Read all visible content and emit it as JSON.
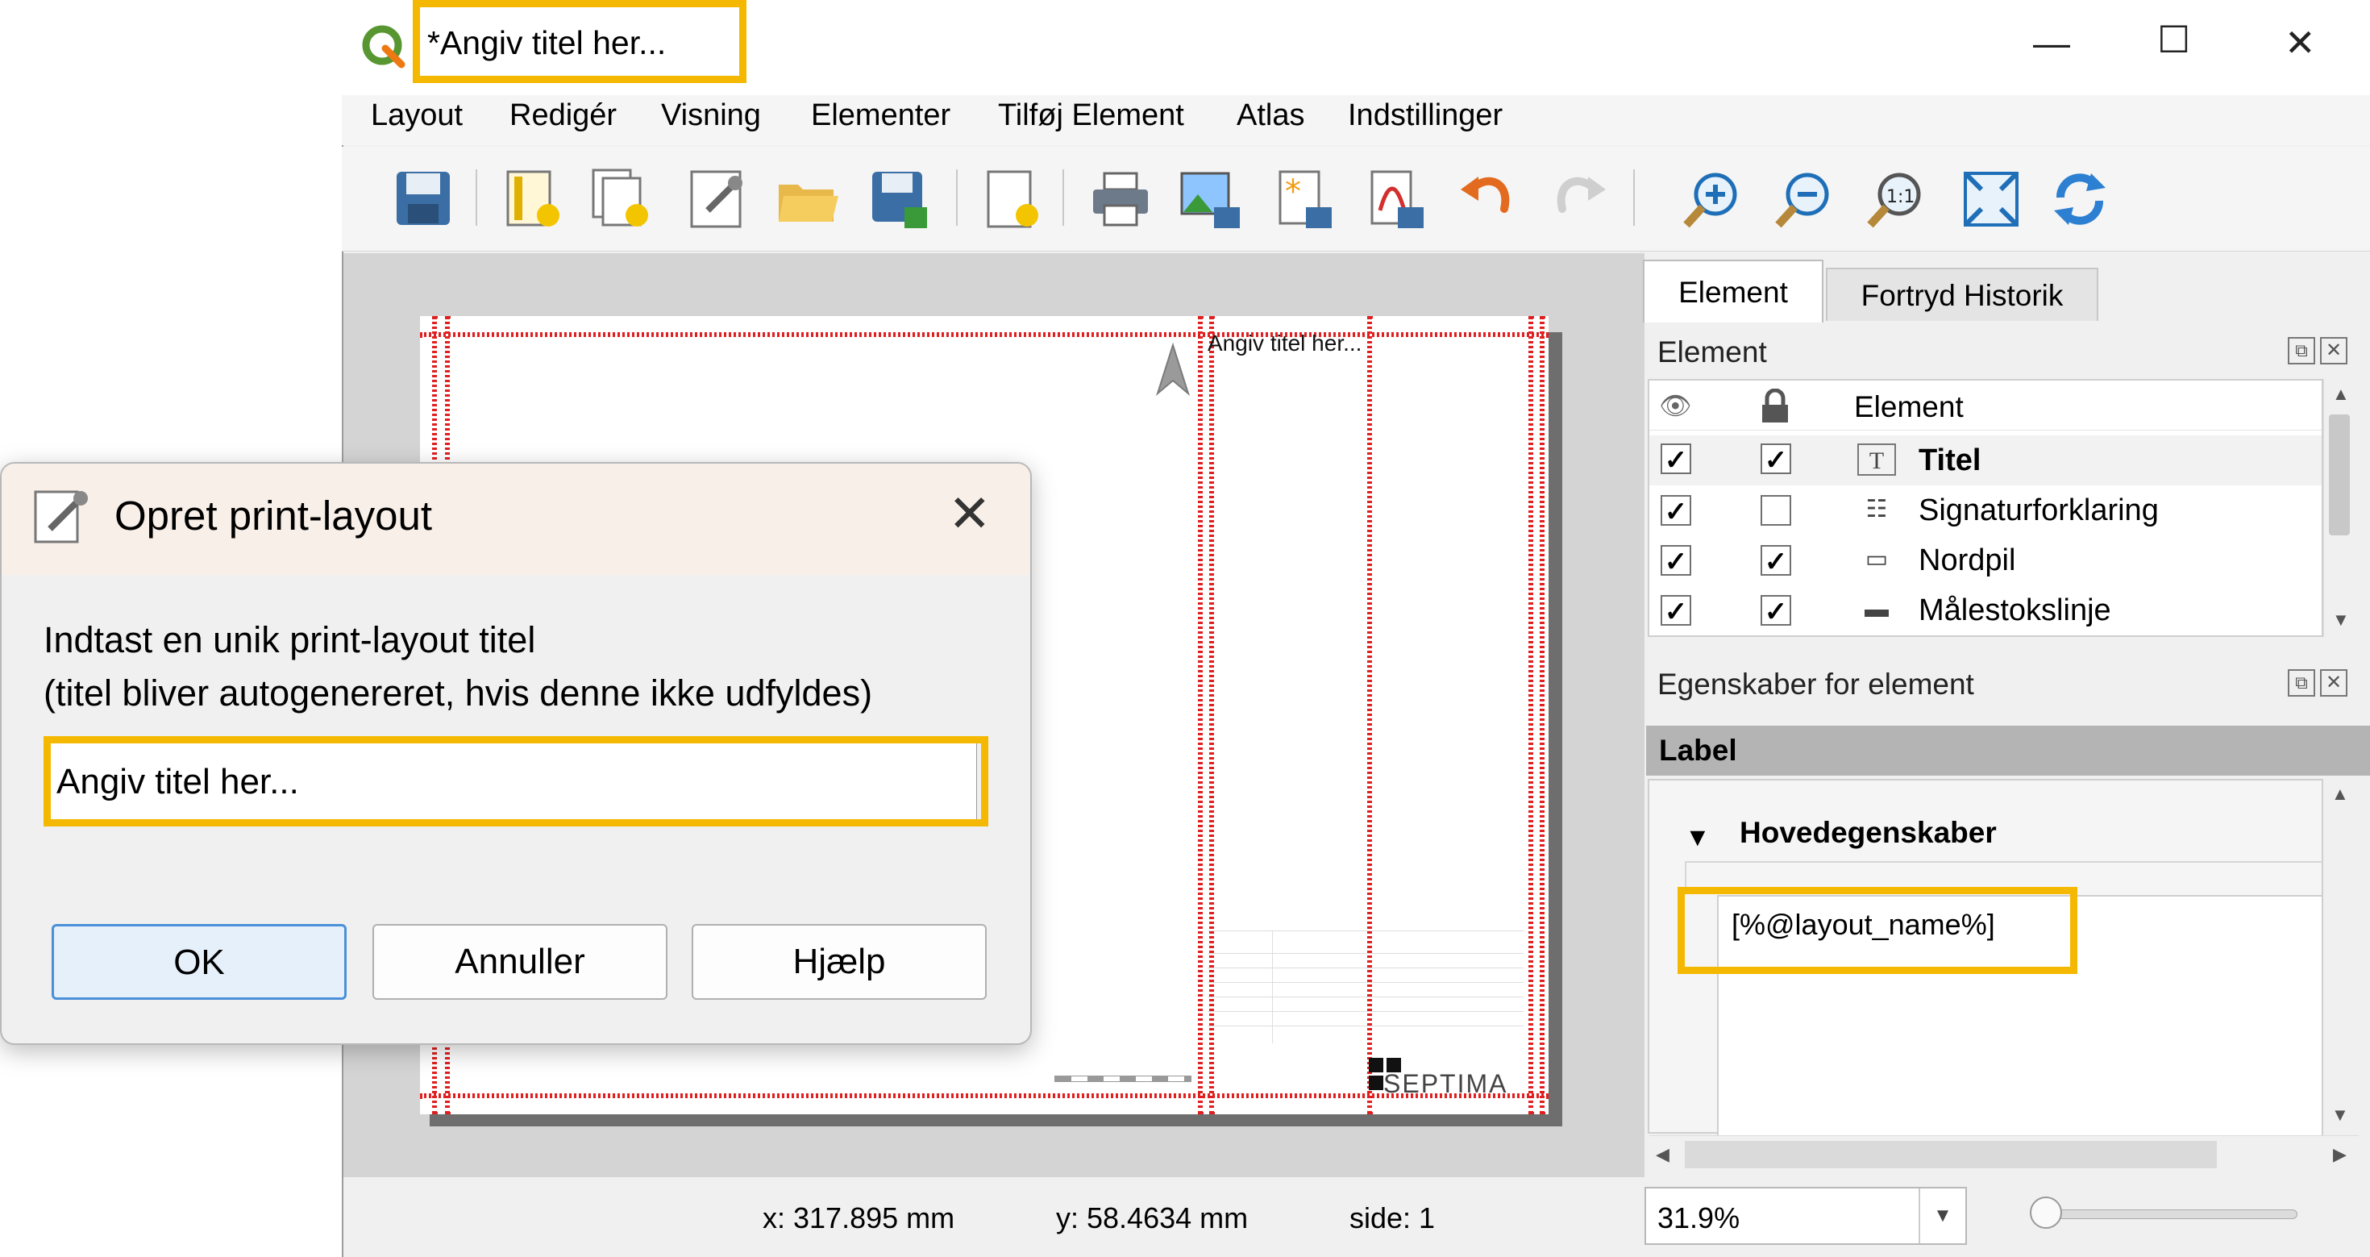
{
  "window": {
    "title": "*Angiv titel her...",
    "controls": {
      "minimize": "—",
      "maximize": "☐",
      "close": "✕"
    }
  },
  "menu": [
    "Layout",
    "Redigér",
    "Visning",
    "Elementer",
    "Tilføj Element",
    "Atlas",
    "Indstillinger"
  ],
  "toolbar_icons": [
    "save-layout-icon",
    "new-layout-icon",
    "duplicate-layout-icon",
    "layout-manager-icon",
    "open-folder-icon",
    "save-as-template-icon",
    "add-pages-icon",
    "print-icon",
    "export-image-icon",
    "export-svg-icon",
    "export-pdf-icon",
    "undo-icon",
    "redo-icon",
    "zoom-in-icon",
    "zoom-out-icon",
    "zoom-actual-icon",
    "zoom-full-icon",
    "refresh-icon"
  ],
  "canvas": {
    "page_title": "Angiv titel her...",
    "logo_text": "SEPTIMA"
  },
  "panel": {
    "tabs": [
      "Element",
      "Fortryd Historik"
    ],
    "element_section": "Element",
    "column_header": "Element",
    "items": [
      {
        "label": "Titel",
        "visible": "✓",
        "locked": "✓",
        "icon": "text-label-icon",
        "glyph": "T"
      },
      {
        "label": "Signaturforklaring",
        "visible": "✓",
        "locked": "",
        "icon": "legend-icon",
        "glyph": "☷"
      },
      {
        "label": "Nordpil",
        "visible": "✓",
        "locked": "✓",
        "icon": "picture-icon",
        "glyph": "▭"
      },
      {
        "label": "Målestokslinje",
        "visible": "✓",
        "locked": "✓",
        "icon": "scalebar-icon",
        "glyph": "▬"
      }
    ],
    "props_section": "Egenskaber for element",
    "label_header": "Label",
    "group_title": "Hovedegenskaber",
    "expression": "[%@layout_name%]"
  },
  "status": {
    "x": "x: 317.895 mm",
    "y": "y: 58.4634 mm",
    "page": "side: 1",
    "zoom": "31.9%"
  },
  "dialog": {
    "title": "Opret print-layout",
    "line1": "Indtast en unik print-layout titel",
    "line2": "(titel bliver autogenereret, hvis denne ikke udfyldes)",
    "input_value": "Angiv titel her...",
    "buttons": {
      "ok": "OK",
      "cancel": "Annuller",
      "help": "Hjælp"
    }
  },
  "colors": {
    "highlight": "#f5b800",
    "guides": "#e02020",
    "accent": "#4a90d9"
  }
}
